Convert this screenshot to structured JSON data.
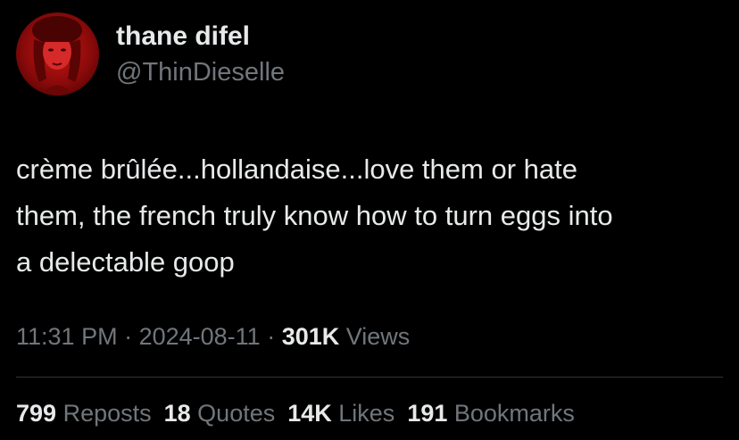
{
  "author": {
    "display_name": "thane difel",
    "handle": "@ThinDieselle",
    "avatar_icon": "profile-photo"
  },
  "tweet": {
    "lines": [
      "crème brûlée...hollandaise...love them or hate",
      "them, the french truly know how to turn eggs into",
      "a delectable goop"
    ]
  },
  "meta": {
    "time": "11:31 PM",
    "separator1": " · ",
    "date": "2024-08-11",
    "separator2": " · ",
    "views_count": "301K",
    "views_label": " Views"
  },
  "stats": {
    "reposts_count": "799",
    "reposts_label": " Reposts",
    "quotes_count": "18",
    "quotes_label": " Quotes",
    "likes_count": "14K",
    "likes_label": " Likes",
    "bookmarks_count": "191",
    "bookmarks_label": " Bookmarks"
  },
  "colors": {
    "background": "#000000",
    "primary_text": "#e7e9ea",
    "secondary_text": "#71767b",
    "divider": "#2f3336",
    "avatar_red": "#c81616"
  }
}
